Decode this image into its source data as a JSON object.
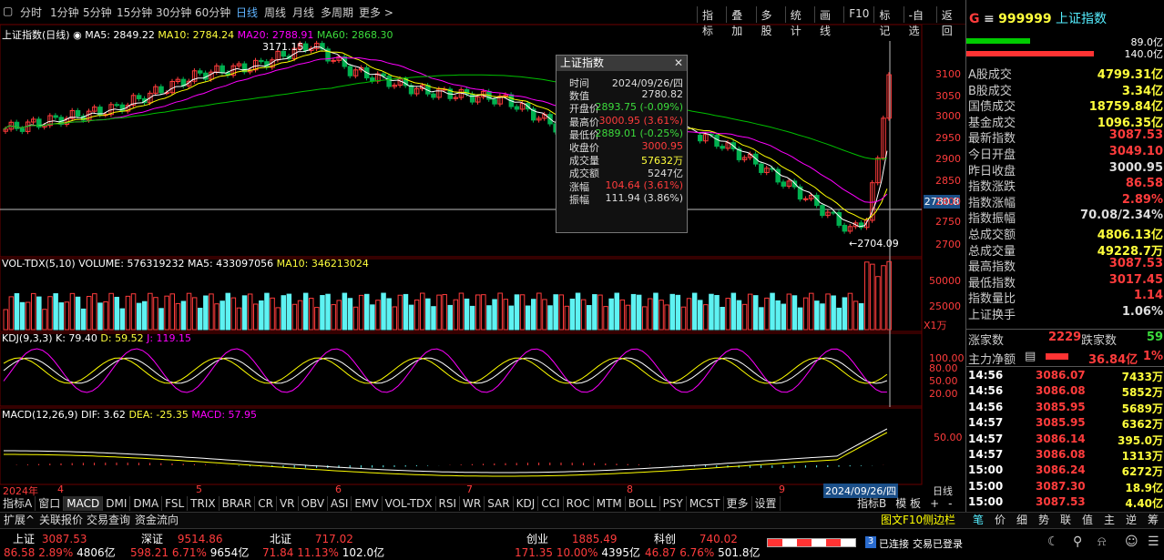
{
  "toolbar": {
    "periods": [
      "分时",
      "1分钟",
      "5分钟",
      "15分钟",
      "30分钟",
      "60分钟",
      "日线",
      "周线",
      "月线",
      "多周期",
      "更多 >"
    ],
    "tools": [
      "指标",
      "叠加",
      "多股",
      "统计",
      "画线",
      "F10",
      "标记",
      "-自选",
      "返回"
    ]
  },
  "legend": {
    "title": "上证指数(日线)",
    "ma5": "MA5: 2849.22",
    "ma10": "MA10: 2784.24",
    "ma20": "MA20: 2788.91",
    "ma60": "MA60: 2868.30",
    "vol": "VOL-TDX(5,10)",
    "volume": "VOLUME: 576319232",
    "vma5": "MA5: 433097056",
    "vma10": "MA10: 346213024",
    "kdj": "KDJ(9,3,3)",
    "k": "K: 79.40",
    "d": "D: 59.52",
    "j": "J: 119.15",
    "macd": "MACD(12,26,9)",
    "dif": "DIF: 3.62",
    "dea": "DEA: -25.35",
    "macdv": "MACD: 57.95",
    "high_mark": "3171.15",
    "low_mark": "2704.09",
    "cursor_price": "2780.8",
    "vol_unit": "X1万"
  },
  "axes": {
    "price": [
      "3100",
      "3050",
      "3000",
      "2950",
      "2900",
      "2850",
      "2800",
      "2750",
      "2700"
    ],
    "vol": [
      "50000",
      "25000"
    ],
    "kdj": [
      "100.00",
      "80.00",
      "50.00",
      "20.00"
    ],
    "macd": [
      "50.00"
    ],
    "months": [
      "2024年",
      "4",
      "5",
      "6",
      "7",
      "8",
      "9"
    ],
    "date_box": "2024/09/26/四",
    "right_label": "日线"
  },
  "tooltip": {
    "title": "上证指数",
    "rows": [
      {
        "k": "时间",
        "v": "2024/09/26/四",
        "c": "w"
      },
      {
        "k": "数值",
        "v": "2780.82",
        "c": "w"
      },
      {
        "k": "开盘价",
        "v": "2893.75 (-0.09%)",
        "c": "g"
      },
      {
        "k": "最高价",
        "v": "3000.95 (3.61%)",
        "c": "r"
      },
      {
        "k": "最低价",
        "v": "2889.01 (-0.25%)",
        "c": "g"
      },
      {
        "k": "收盘价",
        "v": "3000.95",
        "c": "r"
      },
      {
        "k": "成交量",
        "v": "57632万",
        "c": "y"
      },
      {
        "k": "成交额",
        "v": "5247亿",
        "c": "w"
      },
      {
        "k": "涨幅",
        "v": "104.64 (3.61%)",
        "c": "r"
      },
      {
        "k": "振幅",
        "v": "111.94 (3.86%)",
        "c": "w"
      }
    ]
  },
  "tabs": [
    "指标A",
    "窗口",
    "MACD",
    "DMI",
    "DMA",
    "FSL",
    "TRIX",
    "BRAR",
    "CR",
    "VR",
    "OBV",
    "ASI",
    "EMV",
    "VOL-TDX",
    "RSI",
    "WR",
    "SAR",
    "KDJ",
    "CCI",
    "ROC",
    "MTM",
    "BOLL",
    "PSY",
    "MCST",
    "更多",
    "设置"
  ],
  "tabs_right": [
    "指标B",
    "模 板",
    "+",
    "-"
  ],
  "row2": [
    "扩展^",
    "关联报价",
    "交易查询",
    "资金流向"
  ],
  "row2_right": "图文F10 ",
  "row2_right2": "侧边栏",
  "side_tabs": [
    "笔",
    "价",
    "细",
    "势",
    "联",
    "值",
    "主",
    "逆",
    "筹"
  ],
  "quote": {
    "code": "999999",
    "name": "上证指数",
    "bar1": "89.0亿",
    "bar2": "140.0亿",
    "rows": [
      {
        "l": "A股成交",
        "v": "4799.31亿",
        "c": "y"
      },
      {
        "l": "B股成交",
        "v": "3.34亿",
        "c": "y"
      },
      {
        "l": "国债成交",
        "v": "18759.84亿",
        "c": "y"
      },
      {
        "l": "基金成交",
        "v": "1096.35亿",
        "c": "y"
      },
      {
        "l": "最新指数",
        "v": "3087.53",
        "c": "r"
      },
      {
        "l": "今日开盘",
        "v": "3049.10",
        "c": "r"
      },
      {
        "l": "昨日收盘",
        "v": "3000.95",
        "c": "w"
      },
      {
        "l": "指数涨跌",
        "v": "86.58",
        "c": "r"
      },
      {
        "l": "指数涨幅",
        "v": "2.89%",
        "c": "r"
      },
      {
        "l": "指数振幅",
        "v": "70.08/2.34%",
        "c": "w"
      },
      {
        "l": "总成交额",
        "v": "4806.13亿",
        "c": "y"
      },
      {
        "l": "总成交量",
        "v": "49228.7万",
        "c": "y"
      },
      {
        "l": "最高指数",
        "v": "3087.53",
        "c": "r"
      },
      {
        "l": "最低指数",
        "v": "3017.45",
        "c": "r"
      },
      {
        "l": "指数量比",
        "v": "1.14",
        "c": "r"
      },
      {
        "l": "上证换手",
        "v": "1.06%",
        "c": "w"
      }
    ],
    "up_label": "涨家数",
    "up": "2229",
    "down_label": "跌家数",
    "down": "59",
    "flow_label": "主力净额",
    "flow": "36.84亿",
    "flow_pct": "1%"
  },
  "ticks": [
    {
      "t": "14:56",
      "p": "3086.07",
      "v": "7433万"
    },
    {
      "t": "14:56",
      "p": "3086.08",
      "v": "5852万"
    },
    {
      "t": "14:56",
      "p": "3085.95",
      "v": "5689万"
    },
    {
      "t": "14:57",
      "p": "3085.95",
      "v": "6362万"
    },
    {
      "t": "14:57",
      "p": "3086.14",
      "v": "395.0万"
    },
    {
      "t": "14:57",
      "p": "3086.08",
      "v": "1313万"
    },
    {
      "t": "15:00",
      "p": "3086.24",
      "v": "6272万"
    },
    {
      "t": "15:00",
      "p": "3087.30",
      "v": "18.9亿"
    },
    {
      "t": "15:00",
      "p": "3087.53",
      "v": "4.40亿"
    }
  ],
  "status": {
    "sh_label": "上证",
    "sh": "3087.53",
    "sh_chg": "86.58",
    "sh_pct": "2.89%",
    "sh_amt": "4806亿",
    "sz_label": "深证",
    "sz": "9514.86",
    "sz_chg": "598.21",
    "sz_pct": "6.71%",
    "sz_amt": "9654亿",
    "bz_label": "北证",
    "bz": "717.02",
    "bz_chg": "71.84",
    "bz_pct": "11.13%",
    "bz_amt": "102.0亿",
    "cy_label": "创业",
    "cy": "1885.49",
    "cy_chg": "171.35",
    "cy_pct": "10.00%",
    "cy_amt": "4395亿",
    "kc_label": "科创",
    "kc": "740.02",
    "kc_chg": "46.87",
    "kc_pct": "6.76%",
    "kc_amt": "501.8亿",
    "conn": "已连接",
    "trade": "交易已登录"
  },
  "colors": {
    "up": "#ff3c3c",
    "down": "#00b050",
    "ma5": "#ffffff",
    "ma10": "#ffff00",
    "ma20": "#ff00ff",
    "ma60": "#00c000",
    "vol_up": "#ff3c3c",
    "vol_down": "#5ef2f2"
  }
}
